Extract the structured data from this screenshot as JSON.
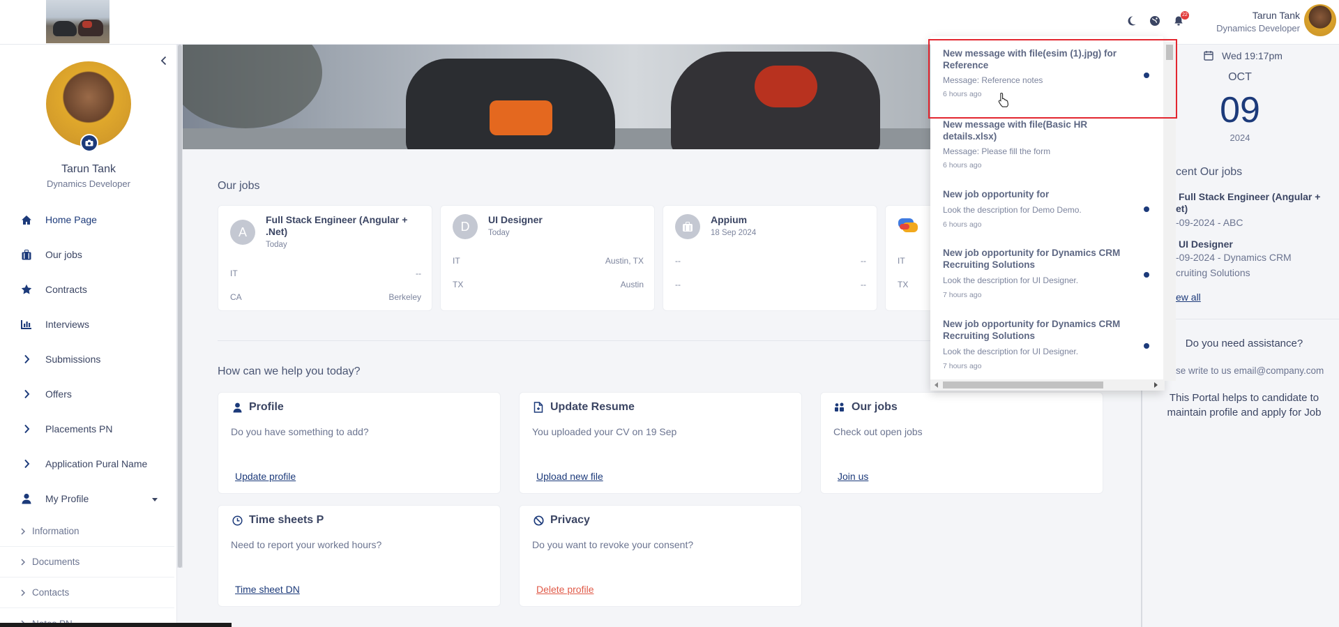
{
  "user": {
    "name": "Tarun Tank",
    "role": "Dynamics Developer"
  },
  "header": {
    "notification_count": "22"
  },
  "sidebar": {
    "items": [
      {
        "label": "Home Page",
        "icon": "home-icon"
      },
      {
        "label": "Our jobs",
        "icon": "briefcase-icon"
      },
      {
        "label": "Contracts",
        "icon": "star-icon"
      },
      {
        "label": "Interviews",
        "icon": "chart-icon"
      },
      {
        "label": "Submissions",
        "icon": "chevron-right-icon"
      },
      {
        "label": "Offers",
        "icon": "chevron-right-icon"
      },
      {
        "label": "Placements PN",
        "icon": "chevron-right-icon"
      },
      {
        "label": "Application Pural Name",
        "icon": "chevron-right-icon"
      },
      {
        "label": "My Profile",
        "icon": "user-icon"
      }
    ],
    "subitems": [
      "Information",
      "Documents",
      "Contacts",
      "Notes PN"
    ]
  },
  "jobs_section": {
    "title": "Our jobs",
    "cards": [
      {
        "avatar": "A",
        "title": "Full Stack Engineer (Angular + .Net)",
        "date": "Today",
        "rows": [
          [
            "IT",
            "--"
          ],
          [
            "CA",
            "Berkeley"
          ]
        ]
      },
      {
        "avatar": "D",
        "title": "UI Designer",
        "date": "Today",
        "rows": [
          [
            "IT",
            "Austin, TX"
          ],
          [
            "TX",
            "Austin"
          ]
        ]
      },
      {
        "avatar": "",
        "title": "Appium",
        "date": "18 Sep 2024",
        "rows": [
          [
            "--",
            "--"
          ],
          [
            "--",
            "--"
          ]
        ]
      },
      {
        "avatar": "",
        "title": "",
        "date": "",
        "rows": [
          [
            "IT",
            ""
          ],
          [
            "TX",
            ""
          ]
        ]
      }
    ]
  },
  "help_section": {
    "title": "How can we help you today?",
    "cards": [
      {
        "icon": "user-icon",
        "title": "Profile",
        "desc": "Do you have something to add?",
        "link": "Update profile"
      },
      {
        "icon": "document-icon",
        "title": "Update Resume",
        "desc": "You uploaded your CV on 19 Sep",
        "link": "Upload new file"
      },
      {
        "icon": "people-icon",
        "title": "Our jobs",
        "desc": "Check out open jobs",
        "link": "Join us"
      },
      {
        "icon": "clock-icon",
        "title": "Time sheets P",
        "desc": "Need to report your worked hours?",
        "link": "Time sheet DN"
      },
      {
        "icon": "ban-icon",
        "title": "Privacy",
        "desc": "Do you want to revoke your consent?",
        "link": "Delete profile"
      }
    ]
  },
  "calendar": {
    "time": "Wed 19:17pm",
    "month": "OCT",
    "day": "09",
    "year": "2024"
  },
  "recent_jobs": {
    "title": "cent Our jobs",
    "items": [
      {
        "title_l1": "Full Stack Engineer (Angular +",
        "title_l2": "et)",
        "sub": "-09-2024 - ABC"
      },
      {
        "title_l1": "UI Designer",
        "title_l2": "",
        "sub": "-09-2024 - Dynamics CRM",
        "sub2": "cruiting Solutions"
      }
    ],
    "view_all": "ew all"
  },
  "assistance": {
    "title": "Do you need assistance?",
    "email_text": "se write to us email@company.com",
    "description": "This Portal helps to candidate to maintain profile and apply for Job"
  },
  "notifications": [
    {
      "title": "New message with file(esim (1).jpg) for Reference",
      "message": "Message: Reference notes",
      "time": "6 hours ago",
      "unread": true
    },
    {
      "title": "New message with file(Basic HR details.xlsx)",
      "message": "Message: Please fill the form",
      "time": "6 hours ago",
      "unread": false
    },
    {
      "title": "New job opportunity for",
      "message": "Look the description for Demo Demo.",
      "time": "6 hours ago",
      "unread": true
    },
    {
      "title": "New job opportunity for Dynamics CRM Recruiting Solutions",
      "message": "Look the description for UI Designer.",
      "time": "7 hours ago",
      "unread": true
    },
    {
      "title": "New job opportunity for Dynamics CRM Recruiting Solutions",
      "message": "Look the description for UI Designer.",
      "time": "7 hours ago",
      "unread": true
    }
  ],
  "colors": {
    "primary": "#1c3a7a",
    "highlight": "#e3262f",
    "danger_link": "#e05a48",
    "badge": "#e23b3b"
  }
}
